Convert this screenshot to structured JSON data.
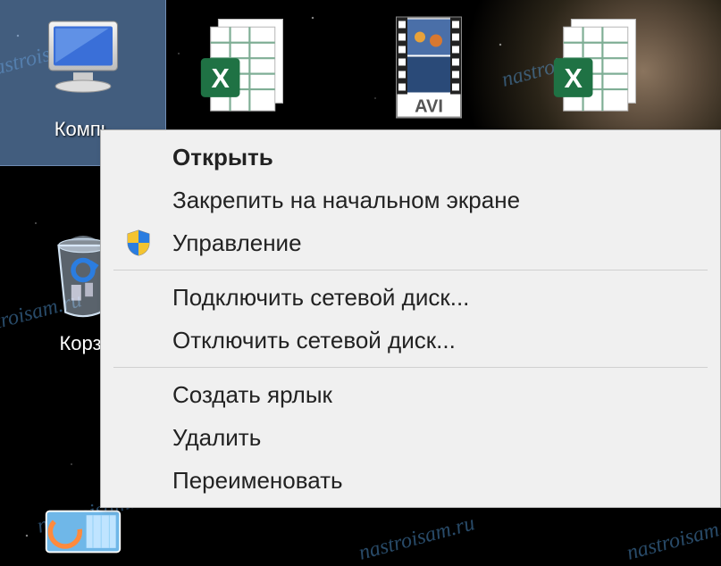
{
  "watermark": "nastroisam.ru",
  "desktop": {
    "icons": [
      {
        "id": "computer",
        "label": "Компь",
        "selected": true
      },
      {
        "id": "recycle",
        "label": "Корзі"
      },
      {
        "id": "gadget",
        "label": ""
      }
    ],
    "topRow": [
      {
        "id": "excel-file-1",
        "type": "xlsx"
      },
      {
        "id": "avi-file",
        "type": "avi",
        "badge": "AVI"
      },
      {
        "id": "excel-file-2",
        "type": "xlsx"
      }
    ]
  },
  "contextMenu": {
    "items": [
      {
        "label": "Открыть",
        "bold": true,
        "icon": null
      },
      {
        "label": "Закрепить на начальном экране",
        "icon": null
      },
      {
        "label": "Управление",
        "icon": "shield"
      },
      {
        "sep": true
      },
      {
        "label": "Подключить сетевой диск...",
        "icon": null
      },
      {
        "label": "Отключить сетевой диск...",
        "icon": null
      },
      {
        "sep": true
      },
      {
        "label": "Создать ярлык",
        "icon": null
      },
      {
        "label": "Удалить",
        "icon": null
      },
      {
        "label": "Переименовать",
        "icon": null
      }
    ]
  }
}
